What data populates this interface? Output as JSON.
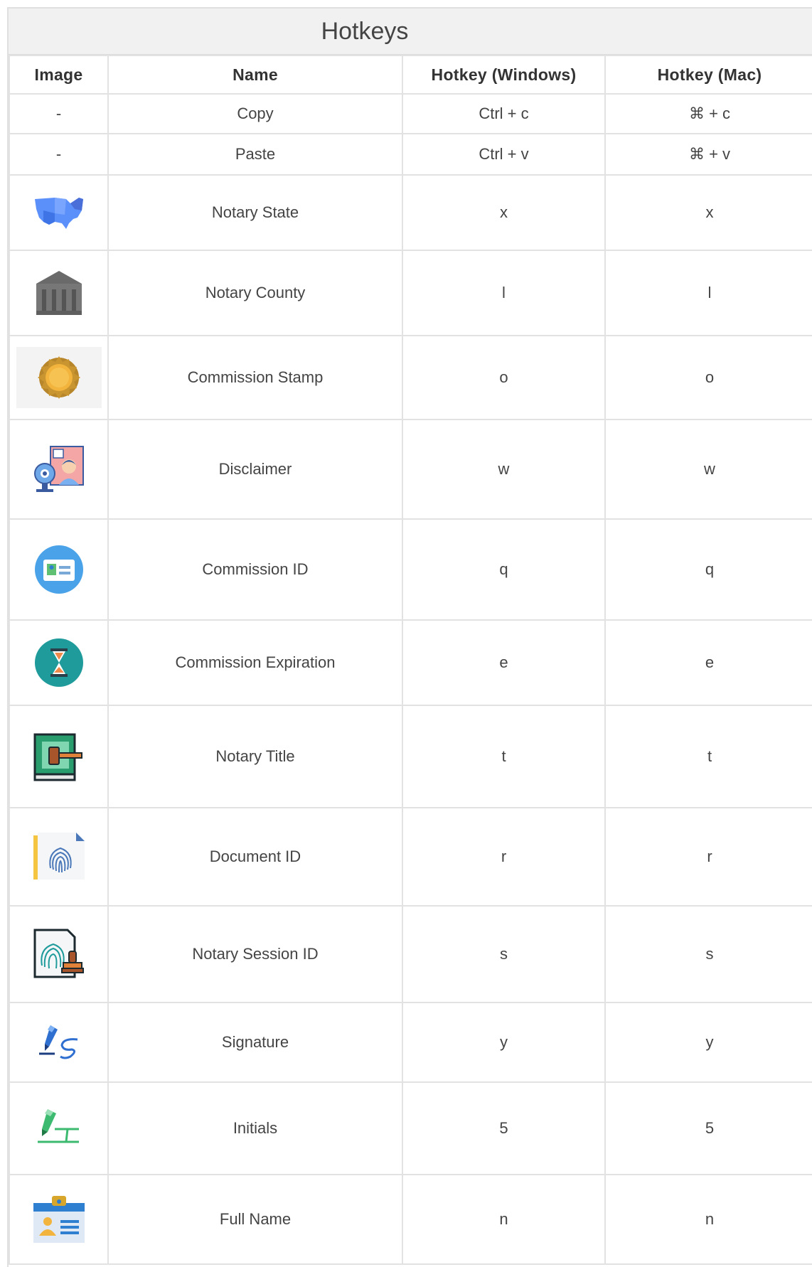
{
  "title": "Hotkeys",
  "columns": [
    "Image",
    "Name",
    "Hotkey (Windows)",
    "Hotkey (Mac)"
  ],
  "rows": [
    {
      "image": "-",
      "name": "Copy",
      "win": "Ctrl + c",
      "mac": "⌘ + c",
      "icon": "none"
    },
    {
      "image": "-",
      "name": "Paste",
      "win": "Ctrl + v",
      "mac": "⌘ + v",
      "icon": "none"
    },
    {
      "name": "Notary State",
      "win": "x",
      "mac": "x",
      "icon": "us-map-icon"
    },
    {
      "name": "Notary County",
      "win": "l",
      "mac": "l",
      "icon": "courthouse-icon"
    },
    {
      "name": "Commission Stamp",
      "win": "o",
      "mac": "o",
      "icon": "seal-stamp-icon"
    },
    {
      "name": "Disclaimer",
      "win": "w",
      "mac": "w",
      "icon": "webcam-person-icon"
    },
    {
      "name": "Commission ID",
      "win": "q",
      "mac": "q",
      "icon": "id-card-icon"
    },
    {
      "name": "Commission Expiration",
      "win": "e",
      "mac": "e",
      "icon": "hourglass-icon"
    },
    {
      "name": "Notary Title",
      "win": "t",
      "mac": "t",
      "icon": "gavel-book-icon"
    },
    {
      "name": "Document ID",
      "win": "r",
      "mac": "r",
      "icon": "fingerprint-document-icon"
    },
    {
      "name": "Notary Session ID",
      "win": "s",
      "mac": "s",
      "icon": "fingerprint-stamp-icon"
    },
    {
      "name": "Signature",
      "win": "y",
      "mac": "y",
      "icon": "signature-pen-icon"
    },
    {
      "name": "Initials",
      "win": "5",
      "mac": "5",
      "icon": "initials-pen-icon"
    },
    {
      "name": "Full Name",
      "win": "n",
      "mac": "n",
      "icon": "name-badge-icon"
    }
  ],
  "colors": {
    "title_bar_bg": "#f1f1f1",
    "border": "#e2e2e2",
    "text": "#444444"
  }
}
